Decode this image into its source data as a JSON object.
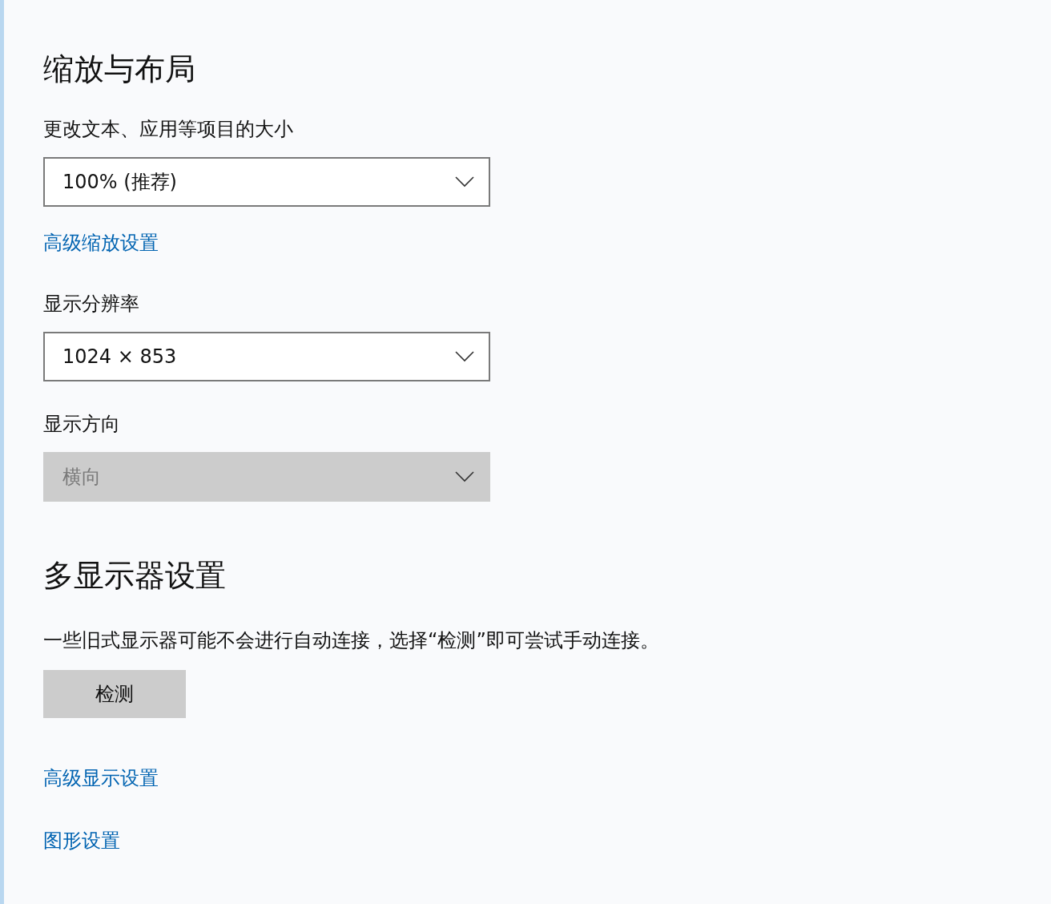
{
  "scale_layout": {
    "title": "缩放与布局",
    "fields": [
      {
        "kind": "dropdown",
        "label": "更改文本、应用等项目的大小",
        "value": "100% (推荐)",
        "disabled": false
      },
      {
        "kind": "link",
        "text": "高级缩放设置"
      },
      {
        "kind": "dropdown",
        "label": "显示分辨率",
        "value": "1024 × 853",
        "disabled": false
      },
      {
        "kind": "dropdown",
        "label": "显示方向",
        "value": "横向",
        "disabled": true
      }
    ]
  },
  "multi_display": {
    "title": "多显示器设置",
    "description": "一些旧式显示器可能不会进行自动连接，选择“检测”即可尝试手动连接。",
    "button": "检测",
    "links": [
      "高级显示设置",
      "图形设置"
    ]
  }
}
